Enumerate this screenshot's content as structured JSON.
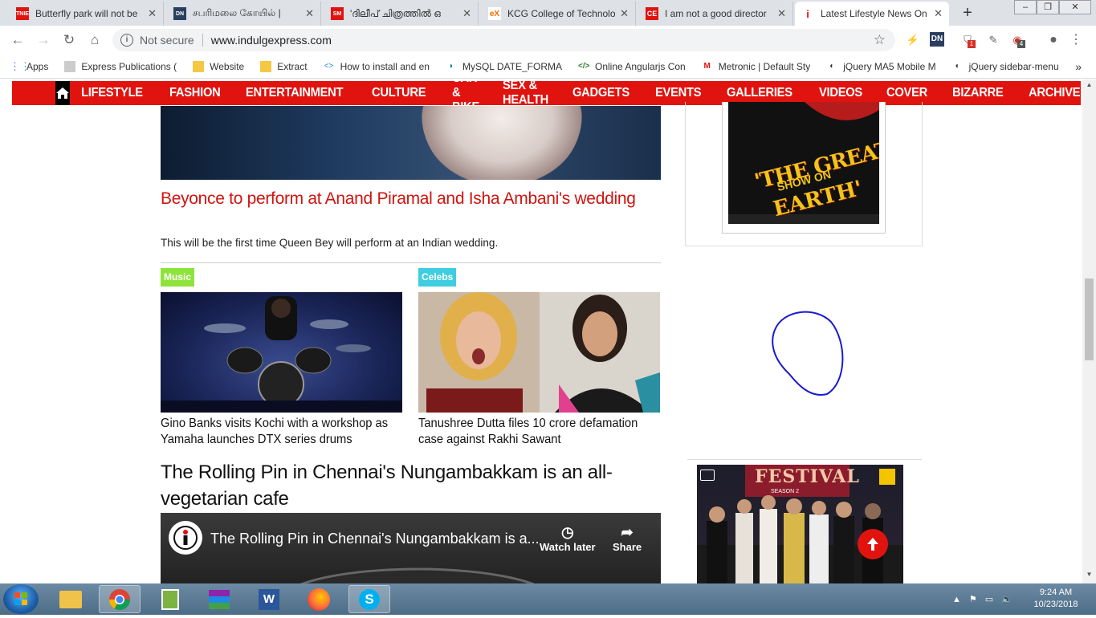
{
  "tabs": [
    {
      "title": "Butterfly park will not be",
      "favicon": "TNIE",
      "color": "#e0130f"
    },
    {
      "title": "சபரிமலை கோயில் |",
      "favicon": "DN",
      "color": "#2a3f5f"
    },
    {
      "title": "'ദിലീപ് ചിത്രത്തിൽ ഒ",
      "favicon": "SM",
      "color": "#e0130f"
    },
    {
      "title": "KCG College of Technolo",
      "favicon": "eX",
      "color": "#ff6a00"
    },
    {
      "title": "I am not a good director",
      "favicon": "CE",
      "color": "#e0130f"
    },
    {
      "title": "Latest Lifestyle News On",
      "favicon": "i",
      "color": "#e0130f"
    }
  ],
  "address": {
    "security": "Not secure",
    "url": "www.indulgexpress.com"
  },
  "extensions": {
    "badge1": "1",
    "badge2": "4"
  },
  "bookmarks": [
    {
      "label": "Apps",
      "icon": "apps-icon"
    },
    {
      "label": "Express Publications (",
      "icon": "page-icon"
    },
    {
      "label": "Website",
      "icon": "folder-icon"
    },
    {
      "label": "Extract",
      "icon": "folder-icon"
    },
    {
      "label": "How to install and en",
      "icon": "code-icon"
    },
    {
      "label": "MySQL DATE_FORMA",
      "icon": "dolphin-icon"
    },
    {
      "label": "Online Angularjs Con",
      "icon": "code-icon"
    },
    {
      "label": "Metronic | Default Sty",
      "icon": "metronic-icon"
    },
    {
      "label": "jQuery MA5 Mobile M",
      "icon": "jquery-icon"
    },
    {
      "label": "jQuery sidebar-menu",
      "icon": "jquery-icon"
    }
  ],
  "nav": [
    "LIFESTYLE",
    "FASHION",
    "ENTERTAINMENT",
    "CULTURE",
    "CAR & BIKE",
    "SEX & HEALTH",
    "GADGETS",
    "EVENTS",
    "GALLERIES",
    "VIDEOS",
    "COVER",
    "BIZARRE",
    "ARCHIVES"
  ],
  "lead": {
    "headline": "Beyonce to perform at Anand Piramal and Isha Ambani's wedding",
    "summary": "This will be the first time Queen Bey will perform at an Indian wedding."
  },
  "cards": [
    {
      "category": "Music",
      "category_color": "#8ee33a",
      "title": "Gino Banks visits Kochi with a workshop as Yamaha launches DTX series drums"
    },
    {
      "category": "Celebs",
      "category_color": "#3fcde0",
      "title": "Tanushree Dutta files 10 crore defamation case against Rakhi Sawant"
    }
  ],
  "feature": {
    "title": "The Rolling Pin in Chennai's Nungambakkam is an all-vegetarian cafe",
    "video_title": "The Rolling Pin in Chennai's Nungambakkam is a...",
    "watch_later": "Watch later",
    "share": "Share"
  },
  "sidebar": {
    "poster_line1": "'THE GREATEST",
    "poster_line2": "SHOW ON",
    "poster_line3": "EARTH'",
    "event_banner": "FESTIVAL",
    "event_sub": "SEASON 2"
  },
  "clock": {
    "time": "9:24 AM",
    "date": "10/23/2018"
  }
}
